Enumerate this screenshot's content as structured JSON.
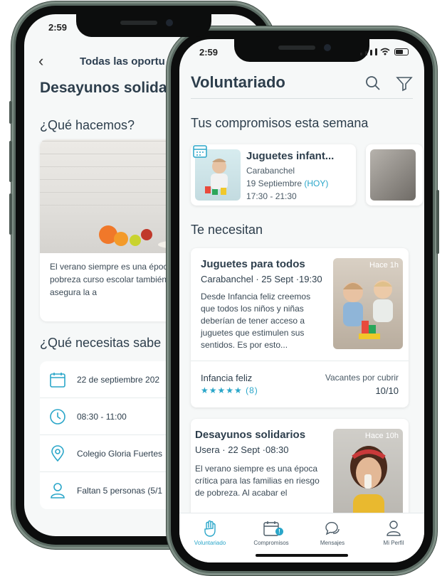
{
  "back_screen": {
    "status_time": "2:59",
    "nav_title": "Todas las oportu",
    "title": "Desayunos solida",
    "section_what": "¿Qué hacemos?",
    "description": "El verano siempre es una époc familias en riesgo de pobreza curso escolar también se aca comedor y no se asegura la a",
    "section_need": "¿Qué necesitas sabe",
    "info": [
      {
        "icon": "calendar-icon",
        "text": "22 de septiembre 202"
      },
      {
        "icon": "clock-icon",
        "text": "08:30 - 11:00"
      },
      {
        "icon": "location-pin-icon",
        "text": "Colegio Gloria Fuertes"
      },
      {
        "icon": "person-icon",
        "text": "Faltan 5 personas (5/1"
      }
    ]
  },
  "front_screen": {
    "status_time": "2:59",
    "title": "Voluntariado",
    "section_commitments": "Tus compromisos esta semana",
    "commitment": {
      "title": "Juguetes infant...",
      "location": "Carabanchel",
      "date": "19 Septiembre",
      "today": "(HOY)",
      "time": "17:30 - 21:30"
    },
    "section_needs": "Te necesitan",
    "needs": [
      {
        "title": "Juguetes para todos",
        "subtitle": "Carabanchel · 25 Sept ·19:30",
        "description": "Desde Infancia feliz creemos que todos los niños y niñas deberían de tener acceso a juguetes que estimulen sus sentidos. Es por esto...",
        "ago": "Hace 1h",
        "org": "Infancia feliz",
        "rating": "★★★★★ (8)",
        "vacancies_label": "Vacantes por cubrir",
        "vacancies": "10/10"
      },
      {
        "title": "Desayunos solidarios",
        "subtitle": "Usera · 22 Sept ·08:30",
        "description": "El verano siempre es una época crítica para las familias en riesgo de pobreza. Al acabar el",
        "ago": "Hace 10h"
      }
    ],
    "tabs": [
      {
        "label": "Voluntariado",
        "icon": "hand-icon",
        "active": true
      },
      {
        "label": "Compromisos",
        "icon": "calendar-icon",
        "badge": "!"
      },
      {
        "label": "Mensajes",
        "icon": "chat-icon"
      },
      {
        "label": "Mi Perfil",
        "icon": "user-icon"
      }
    ]
  },
  "colors": {
    "accent": "#2aa6c9",
    "text": "#2d3e4c",
    "frame": "#5b6b63"
  }
}
